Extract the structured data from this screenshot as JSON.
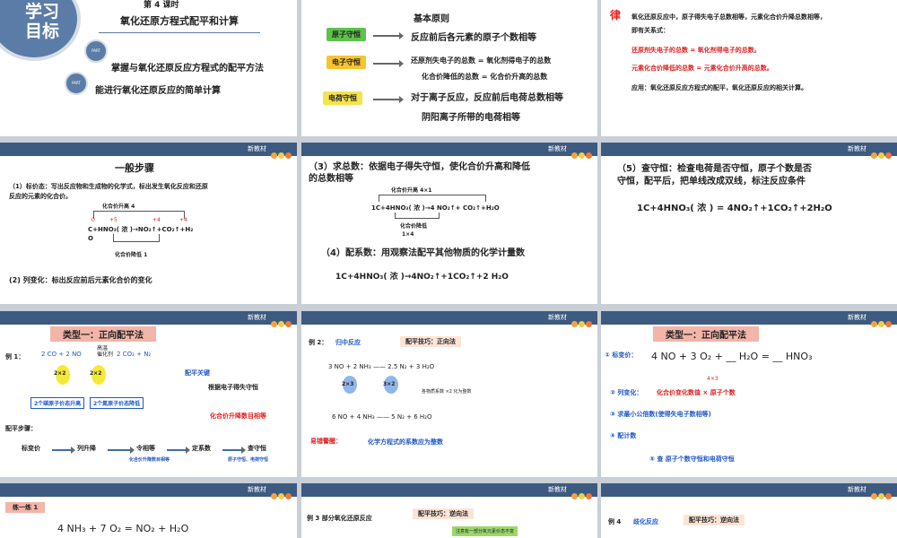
{
  "s1": {
    "badge1": "学习",
    "badge2": "目标",
    "lesson": "第 4 课时",
    "title": "氧化还原方程式配平和计算",
    "goal1": "掌握与氧化还原反应方程式的配平方法",
    "goal2": "能进行氧化还原反应的简单计算",
    "part_tag": "PART"
  },
  "s2": {
    "heading": "基本原则",
    "tag1": "原子守恒",
    "tag2": "电子守恒",
    "tag3": "电荷守恒",
    "p1": "反应前后各元素的原子个数相等",
    "p2a": "还原剂失电子的总数 = 氧化剂得电子的总数",
    "p2b": "化合价降低的总数 = 化合价升高的总数",
    "p3a": "对于离子反应，反应前后电荷总数相等",
    "p3b": "阴阳离子所带的电荷相等"
  },
  "s3": {
    "label": "律",
    "line1": "氧化还原反应中，原子得失电子总数相等，元素化合价升降总数相等，",
    "line2": "即有关系式：",
    "red1": "还原剂失电子的总数 = 氧化剂得电子的总数。",
    "red2": "元素化合价降低的总数 = 元素化合价升高的总数。",
    "app": "应用：氧化还原反应方程式的配平，氧化还原反应的相关计算。"
  },
  "header": {
    "new_textbook": "新教材"
  },
  "s4": {
    "title": "一般步骤",
    "step1a": "（1）标价态：写出反应物和生成物的化学式，标出发生氧化反应和还原",
    "step1b": "反应的元素的化合价。",
    "rise": "化合价升高 4",
    "fall": "化合价降低 1",
    "v0": "0",
    "v5": "+5",
    "v4a": "+4",
    "v4b": "+4",
    "eq": "C+HNO₃( 浓 )→NO₂↑+CO₂↑+H₂",
    "o": "O",
    "step2": "(2) 列变化：标出反应前后元素化合价的变化"
  },
  "s5": {
    "step3a": "（3）求总数：依据电子得失守恒，使化合价升高和降低",
    "step3b": "的总数相等",
    "rise": "化合价升高 4×1",
    "fall": "化合价降低",
    "fall2": "1×4",
    "eq": "1C+4HNO₃( 浓 )→4 NO₂↑+  CO₂↑+H₂O",
    "step4": "（4）配系数：用观察法配平其他物质的化学计量数",
    "eq2": "1C+4HNO₃( 浓 )→4NO₂↑+1CO₂↑+2 H₂O"
  },
  "s6": {
    "step5a": "（5）查守恒：检查电荷是否守恒，原子个数是否",
    "step5b": "守恒，配平后，把单线改成双线，标注反应条件",
    "eq": "1C+4HNO₃( 浓 ) = 4NO₂↑+1CO₂↑+2H₂O"
  },
  "s7": {
    "type": "类型一：正向配平法",
    "ex": "例 1：",
    "formula": "2  CO  +  2 NO",
    "catalyst": "高温\n催化剂",
    "product": "2 CO₂ + N₂",
    "c1": "2×2",
    "c2": "2×2",
    "box1": "2个碳原子价态升高",
    "box2": "2个氮原子价态降低",
    "key": "配平关键",
    "key1": "根据电子得失守恒",
    "key2": "化合价升降数目相等",
    "steps_title": "配平步骤：",
    "st1": "标变价",
    "st2": "列升降",
    "st3": "令相等",
    "st4": "定系数",
    "st5": "查守恒",
    "note1": "化合价升降数目相等",
    "note2": "原子守恒、电荷守恒"
  },
  "s8": {
    "ex": "例 2：",
    "topic": "归中反应",
    "tip": "配平技巧：正向法",
    "eq1": "3 NO +  2 NH₃  —— 2.5 N₂ + 3 H₂O",
    "c1": "2×3",
    "c2": "3×2",
    "note": "各物质系数 ×2 化为整数",
    "eq2": "6 NO + 4 NH₃  —— 5 N₂ + 6 H₂O",
    "warn_label": "易错警醒：",
    "warn": "化学方程式的系数应为整数"
  },
  "s9": {
    "type": "类型一：正向配平法",
    "e1": "① 标变价：",
    "eq": "4 NO + 3 O₂ + __ H₂O = __ HNO₃",
    "mul": "4×3",
    "e2": "② 列变化：",
    "e2b": "化合价变化数值 × 原子个数",
    "e3": "③ 求最小公倍数(使得失电子数相等)",
    "e4": "④ 配计数",
    "e5": "⑤ 查 原子个数守恒和电荷守恒"
  },
  "s10": {
    "tag": "练一练 1",
    "eq": "4 NH₃ + 7  O₂ =  NO₂ + H₂O"
  },
  "s11": {
    "ex": "例 3  部分氧化还原反应",
    "tip": "配平技巧：逆向法",
    "note": "注意有一部分氧元素价态不变"
  },
  "s12": {
    "ex": "例 4",
    "topic": "歧化反应",
    "tip": "配平技巧：逆向法"
  }
}
